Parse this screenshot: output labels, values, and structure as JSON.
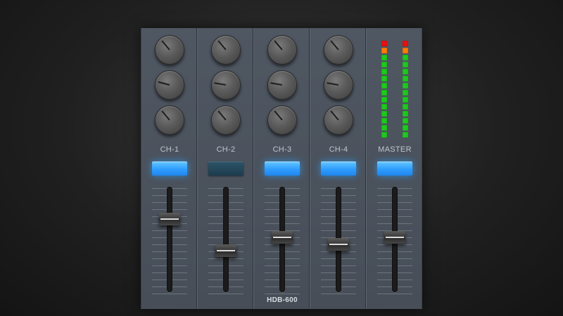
{
  "mixer": {
    "model": "HDB-600",
    "accent_on": "#2f9dff",
    "accent_off": "#1c3c4e",
    "channels": [
      {
        "label": "CH-1",
        "button_on": true,
        "knobs": [
          -40,
          -75,
          -40
        ],
        "fader_level": 0.72
      },
      {
        "label": "CH-2",
        "button_on": false,
        "knobs": [
          -40,
          -80,
          -40
        ],
        "fader_level": 0.38
      },
      {
        "label": "CH-3",
        "button_on": true,
        "knobs": [
          -40,
          -80,
          -40
        ],
        "fader_level": 0.52
      },
      {
        "label": "CH-4",
        "button_on": true,
        "knobs": [
          -40,
          -80,
          -40
        ],
        "fader_level": 0.45
      },
      {
        "label": "MASTER",
        "button_on": true,
        "fader_level": 0.52
      }
    ],
    "master_meter": {
      "segments": 14,
      "left_level": 1.0,
      "right_level": 1.0,
      "colors": {
        "green": "#1ec81e",
        "orange": "#ff7a00",
        "red": "#e81010"
      }
    }
  }
}
